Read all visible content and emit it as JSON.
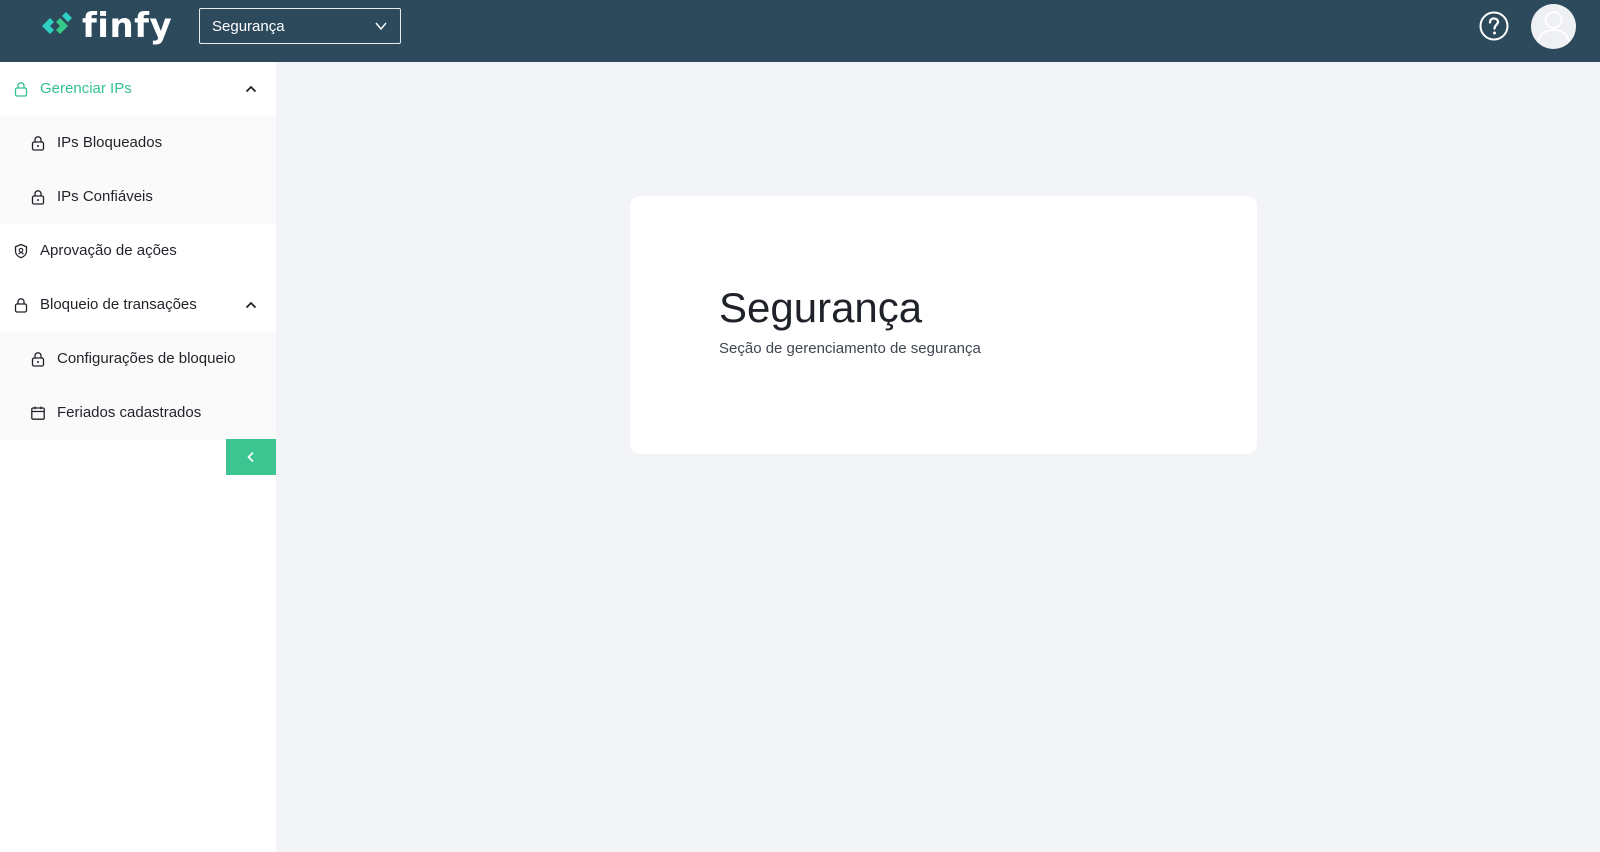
{
  "header": {
    "logo_text": "finfy",
    "module_select": {
      "value": "Segurança"
    },
    "help_icon": "help-circle-icon",
    "avatar_icon": "user-icon"
  },
  "sidebar": {
    "items": [
      {
        "label": "Gerenciar IPs",
        "icon": "lock-icon",
        "expanded": true,
        "active": true
      },
      {
        "label": "IPs Bloqueados",
        "icon": "lock-icon"
      },
      {
        "label": "IPs Confiáveis",
        "icon": "lock-icon"
      },
      {
        "label": "Aprovação de ações",
        "icon": "shield-icon"
      },
      {
        "label": "Bloqueio de transações",
        "icon": "lock-icon",
        "expanded": true
      },
      {
        "label": "Configurações de bloqueio",
        "icon": "lock-icon"
      },
      {
        "label": "Feriados cadastrados",
        "icon": "calendar-icon"
      }
    ],
    "collapse_icon": "chevron-left-icon"
  },
  "main": {
    "title": "Segurança",
    "subtitle": "Seção de gerenciamento de segurança"
  },
  "colors": {
    "header_bg": "#2d4a5d",
    "accent": "#35c28e",
    "page_bg": "#f3f4f8"
  }
}
